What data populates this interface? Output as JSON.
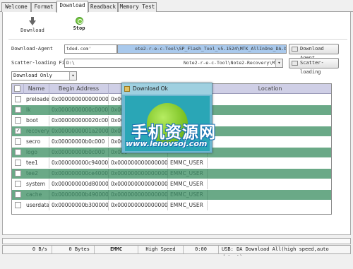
{
  "tabs": [
    "Welcome",
    "Format",
    "Download",
    "Readback",
    "Memory Test"
  ],
  "toolbar": {
    "download_label": "Download",
    "stop_label": "Stop"
  },
  "download_agent": {
    "label": "Download-Agent",
    "path_prefix": "tded.com'",
    "path_visible": "ote2-r-e-c-Tool\\SP_Flash_Tool_v5.1524\\MTK_AllInOne_DA.bin",
    "button": "Download Agent"
  },
  "scatter": {
    "label": "Scatter-loading File",
    "path_prefix": "D:\\",
    "path_visible": "Note2-r-e-c-Tool\\Note2-Recovery\\MT67",
    "button": "Scatter-loading"
  },
  "mode": {
    "selected": "Download Only"
  },
  "table": {
    "headers": [
      "Name",
      "Begin Address",
      "E",
      "",
      "Location"
    ],
    "rows": [
      {
        "name": "preloader",
        "begin": "0x0000000000000000",
        "end": "0x000",
        "region": "",
        "location": "",
        "checked": false
      },
      {
        "name": "lk",
        "begin": "0x0000000000c00000",
        "end": "0x000",
        "region": "",
        "location": "",
        "checked": false
      },
      {
        "name": "boot",
        "begin": "0x000000000020c0000",
        "end": "0x000",
        "region": "",
        "location": "",
        "checked": false
      },
      {
        "name": "recovery",
        "begin": "0x0000000001a20000",
        "end": "0x000",
        "region": "",
        "location": "",
        "checked": true
      },
      {
        "name": "secro",
        "begin": "0x00000000b0c000",
        "end": "0x000",
        "region": "",
        "location": "",
        "checked": false
      },
      {
        "name": "logo",
        "begin": "0x00000000b0c000",
        "end": "0x000",
        "region": "",
        "location": "",
        "checked": false
      },
      {
        "name": "tee1",
        "begin": "0x000000000c940000",
        "end": "0x0000000000000000",
        "region": "EMMC_USER",
        "location": "",
        "checked": false
      },
      {
        "name": "tee2",
        "begin": "0x000000000ce40000",
        "end": "0x0000000000000000",
        "region": "EMMC_USER",
        "location": "",
        "checked": false
      },
      {
        "name": "system",
        "begin": "0x000000000d800000",
        "end": "0x0000000000000000",
        "region": "EMMC_USER",
        "location": "",
        "checked": false
      },
      {
        "name": "cache",
        "begin": "0x00000000b4900000",
        "end": "0x0000000000000000",
        "region": "EMMC_USER",
        "location": "",
        "checked": false
      },
      {
        "name": "userdata",
        "begin": "0x00000000b3000000",
        "end": "0x0000000000000000",
        "region": "EMMC_USER",
        "location": "",
        "checked": false
      }
    ]
  },
  "dialog": {
    "title": "Download Ok"
  },
  "watermark": {
    "cn": "手机资源网",
    "url": "www.lenovsoj.com"
  },
  "status": {
    "speed": "0 B/s",
    "bytes": "0 Bytes",
    "storage": "EMMC",
    "mode": "High Speed",
    "time": "0:00",
    "message": "USB: DA Download All(high speed,auto detect)"
  },
  "colors": {
    "alt_row": "#6aa987",
    "header": "#cfcfe6",
    "dialog": "#2aa6b6",
    "watermark_blue": "#1a6fb0"
  }
}
